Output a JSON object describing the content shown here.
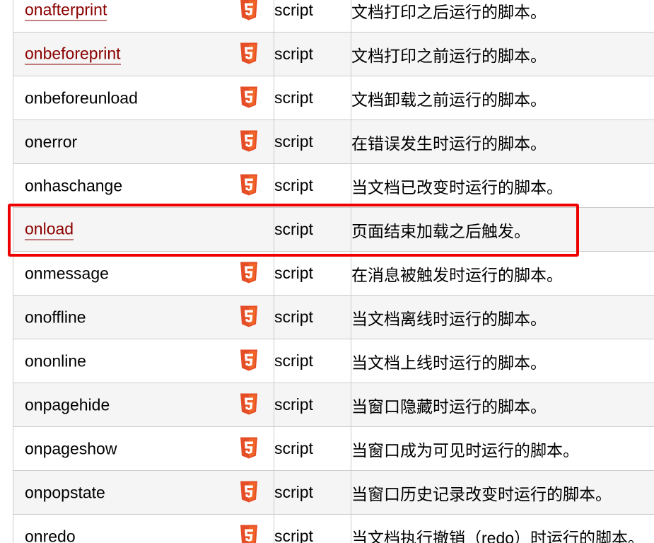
{
  "icon_name": "html5-icon",
  "colors": {
    "link": "#8b0000",
    "row_alt": "#f5f5f5",
    "border": "#cccccc",
    "highlight": "#ee0000",
    "html5_badge": "#e44d26"
  },
  "rows": [
    {
      "name": "onafterprint",
      "is_link": true,
      "html5": true,
      "value": "script",
      "desc": "文档打印之后运行的脚本。"
    },
    {
      "name": "onbeforeprint",
      "is_link": true,
      "html5": true,
      "value": "script",
      "desc": "文档打印之前运行的脚本。"
    },
    {
      "name": "onbeforeunload",
      "is_link": false,
      "html5": true,
      "value": "script",
      "desc": "文档卸载之前运行的脚本。"
    },
    {
      "name": "onerror",
      "is_link": false,
      "html5": true,
      "value": "script",
      "desc": "在错误发生时运行的脚本。"
    },
    {
      "name": "onhaschange",
      "is_link": false,
      "html5": true,
      "value": "script",
      "desc": "当文档已改变时运行的脚本。"
    },
    {
      "name": "onload",
      "is_link": true,
      "html5": false,
      "value": "script",
      "desc": "页面结束加载之后触发。",
      "highlighted": true
    },
    {
      "name": "onmessage",
      "is_link": false,
      "html5": true,
      "value": "script",
      "desc": "在消息被触发时运行的脚本。"
    },
    {
      "name": "onoffline",
      "is_link": false,
      "html5": true,
      "value": "script",
      "desc": "当文档离线时运行的脚本。"
    },
    {
      "name": "ononline",
      "is_link": false,
      "html5": true,
      "value": "script",
      "desc": "当文档上线时运行的脚本。"
    },
    {
      "name": "onpagehide",
      "is_link": false,
      "html5": true,
      "value": "script",
      "desc": "当窗口隐藏时运行的脚本。"
    },
    {
      "name": "onpageshow",
      "is_link": false,
      "html5": true,
      "value": "script",
      "desc": "当窗口成为可见时运行的脚本。"
    },
    {
      "name": "onpopstate",
      "is_link": false,
      "html5": true,
      "value": "script",
      "desc": "当窗口历史记录改变时运行的脚本。"
    },
    {
      "name": "onredo",
      "is_link": false,
      "html5": true,
      "value": "script",
      "desc": "当文档执行撤销（redo）时运行的脚本。"
    }
  ]
}
